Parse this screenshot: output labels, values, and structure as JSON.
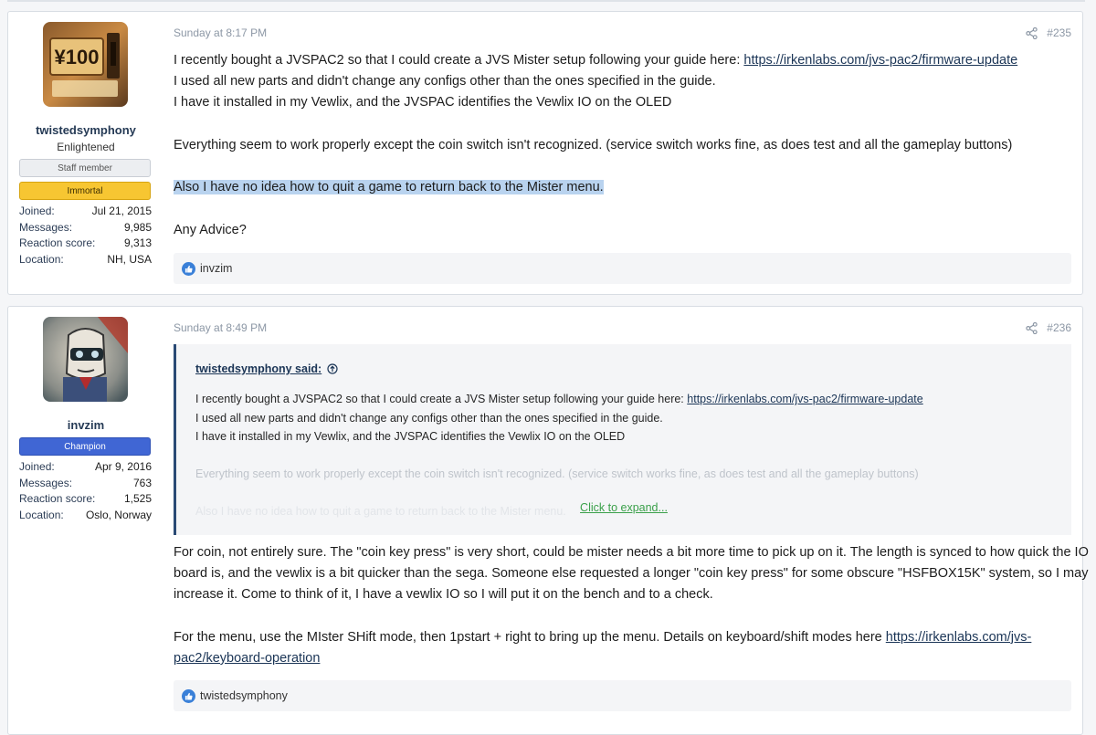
{
  "posts": [
    {
      "user": {
        "name": "twistedsymphony",
        "title": "Enlightened",
        "banners": [
          "Staff member",
          "Immortal"
        ],
        "stats": [
          {
            "key": "Joined:",
            "value": "Jul 21, 2015"
          },
          {
            "key": "Messages:",
            "value": "9,985"
          },
          {
            "key": "Reaction score:",
            "value": "9,313"
          },
          {
            "key": "Location:",
            "value": "NH, USA"
          }
        ]
      },
      "date": "Sunday at 8:17 PM",
      "number": "#235",
      "body": {
        "l1_text": "I recently bought a JVSPAC2 so that I could create a JVS Mister setup following your guide here: ",
        "l1_link": "https://irkenlabs.com/jvs-pac2/firmware-update",
        "l2": "I used all new parts and didn't change any configs other than the ones specified in the guide.",
        "l3": "I have it installed in my Vewlix, and the JVSPAC identifies the Vewlix IO on the OLED",
        "l4": "Everything seem to work properly except the coin switch isn't recognized. (service switch works fine, as does test and all the gameplay buttons)",
        "l5": "Also I have no idea how to quit a game to return back to the Mister menu.",
        "l6": "Any Advice?"
      },
      "reaction_user": "invzim"
    },
    {
      "user": {
        "name": "invzim",
        "banners": [
          "Champion"
        ],
        "stats": [
          {
            "key": "Joined:",
            "value": "Apr 9, 2016"
          },
          {
            "key": "Messages:",
            "value": "763"
          },
          {
            "key": "Reaction score:",
            "value": "1,525"
          },
          {
            "key": "Location:",
            "value": "Oslo, Norway"
          }
        ]
      },
      "date": "Sunday at 8:49 PM",
      "number": "#236",
      "quote": {
        "author": "twistedsymphony said:",
        "l1_text": "I recently bought a JVSPAC2 so that I could create a JVS Mister setup following your guide here: ",
        "l1_link": "https://irkenlabs.com/jvs-pac2/firmware-update",
        "l2": "I used all new parts and didn't change any configs other than the ones specified in the guide.",
        "l3": "I have it installed in my Vewlix, and the JVSPAC identifies the Vewlix IO on the OLED",
        "l4": "Everything seem to work properly except the coin switch isn't recognized. (service switch works fine, as does test and all the gameplay buttons)",
        "l5": "Also I have no idea how to quit a game to return back to the Mister menu.",
        "expand": "Click to expand..."
      },
      "body": {
        "l1": "For coin, not entirely sure. The \"coin key press\" is very short, could be mister needs a bit more time to pick up on it. The length is synced to how quick the IO",
        "l2": "board is, and the vewlix is a bit quicker than the sega. Someone else requested a longer \"coin key press\" for some obscure \"HSFBOX15K\" system, so I may",
        "l3": "increase it. Come to think of it, I have a vewlix IO so I will put it on the bench and to a check.",
        "l4_text": "For the menu, use the MIster SHift mode, then 1pstart + right to bring up the menu. Details on keyboard/shift modes here ",
        "l4_link": "https://irkenlabs.com/jvs-",
        "l5_link": "pac2/keyboard-operation"
      },
      "reaction_user": "twistedsymphony"
    }
  ],
  "icons": {
    "share": "share-icon",
    "like": "like-icon",
    "up_arrow": "circle-arrow-up-icon"
  }
}
